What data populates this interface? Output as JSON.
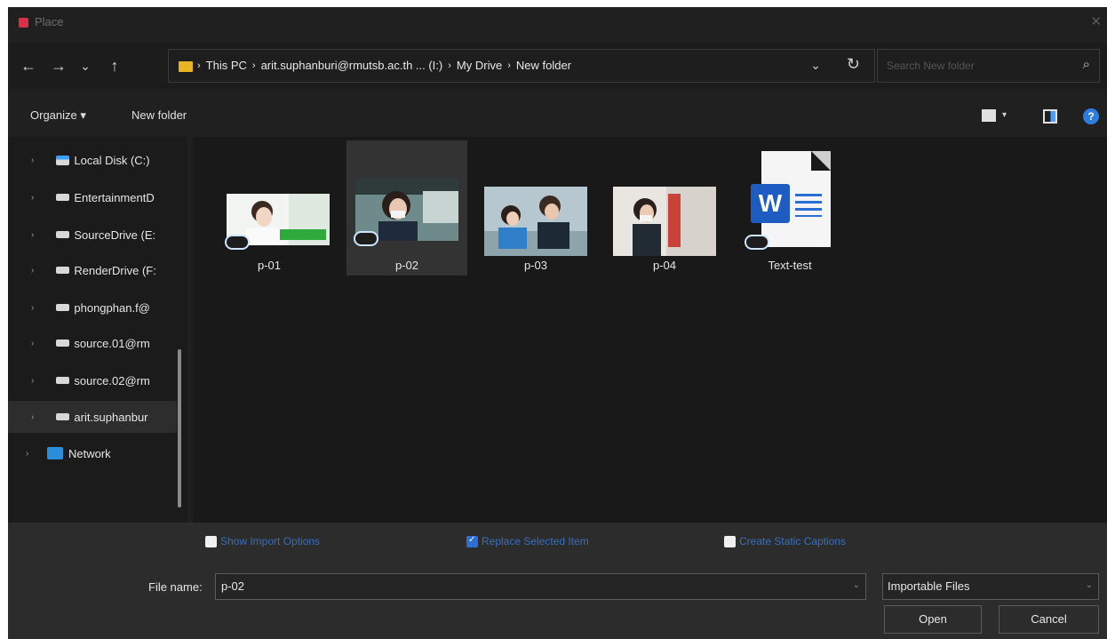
{
  "window": {
    "title": "Place",
    "close_glyph": "✕"
  },
  "nav": {
    "back_glyph": "←",
    "forward_glyph": "→",
    "recent_glyph": "⌄",
    "up_glyph": "↑",
    "breadcrumbs": [
      "This PC",
      "arit.suphanburi@rmutsb.ac.th ... (I:)",
      "My Drive",
      "New folder"
    ],
    "crumb_sep": "›",
    "dropdown_glyph": "⌄",
    "refresh_glyph": "↻",
    "search_placeholder": "Search New folder",
    "search_glyph": "⌕"
  },
  "toolbar": {
    "organize_label": "Organize ▾",
    "new_folder_label": "New folder",
    "view_dropdown_glyph": "▾",
    "help_glyph": "?"
  },
  "sidebar": {
    "chevron": "›",
    "items": [
      {
        "label": "Local Disk (C:)",
        "icon": "windows-drive-icon"
      },
      {
        "label": "EntertainmentD",
        "icon": "drive-icon"
      },
      {
        "label": "SourceDrive (E:",
        "icon": "drive-icon"
      },
      {
        "label": "RenderDrive (F:",
        "icon": "drive-icon"
      },
      {
        "label": "phongphan.f@",
        "icon": "drive-icon"
      },
      {
        "label": "source.01@rm",
        "icon": "drive-icon"
      },
      {
        "label": "source.02@rm",
        "icon": "drive-icon"
      },
      {
        "label": "arit.suphanbur",
        "icon": "drive-icon"
      },
      {
        "label": "Network",
        "icon": "network-icon"
      }
    ]
  },
  "files": [
    {
      "name": "p-01",
      "type": "image",
      "selected": false
    },
    {
      "name": "p-02",
      "type": "image",
      "selected": true
    },
    {
      "name": "p-03",
      "type": "image",
      "selected": false
    },
    {
      "name": "p-04",
      "type": "image",
      "selected": false
    },
    {
      "name": "Text-test",
      "type": "word",
      "selected": false,
      "badge": "W"
    }
  ],
  "options": {
    "show_import_options": {
      "label": "Show Import Options",
      "checked": false
    },
    "replace_selected_item": {
      "label": "Replace Selected Item",
      "checked": true
    },
    "create_static_captions": {
      "label": "Create Static Captions",
      "checked": false
    }
  },
  "footer": {
    "file_name_label": "File name:",
    "file_name_value": "p-02",
    "dropdown_glyph": "⌄",
    "file_type_value": "Importable Files",
    "open_label": "Open",
    "cancel_label": "Cancel"
  },
  "colors": {
    "accent": "#2e6fd6",
    "folder": "#e8b524",
    "app_icon": "#d9304a",
    "word": "#1f5cc2"
  }
}
